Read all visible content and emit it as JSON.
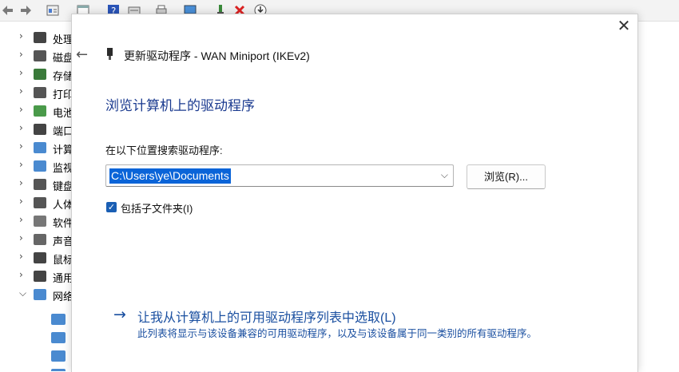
{
  "colors": {
    "accent": "#1a3a8f",
    "link": "#1a4fa0",
    "selection": "#0a64d8"
  },
  "background_tree": {
    "items": [
      {
        "label": "处理",
        "icon": "processor-icon",
        "expanded": false
      },
      {
        "label": "磁盘",
        "icon": "disk-drive-icon",
        "expanded": false
      },
      {
        "label": "存储",
        "icon": "storage-controller-icon",
        "expanded": false
      },
      {
        "label": "打印",
        "icon": "printer-icon",
        "expanded": false
      },
      {
        "label": "电池",
        "icon": "battery-icon",
        "expanded": false
      },
      {
        "label": "端口",
        "icon": "port-icon",
        "expanded": false
      },
      {
        "label": "计算",
        "icon": "computer-icon",
        "expanded": false
      },
      {
        "label": "监视",
        "icon": "monitor-icon",
        "expanded": false
      },
      {
        "label": "键盘",
        "icon": "keyboard-icon",
        "expanded": false
      },
      {
        "label": "人体",
        "icon": "hid-icon",
        "expanded": false
      },
      {
        "label": "软件",
        "icon": "software-device-icon",
        "expanded": false
      },
      {
        "label": "声音",
        "icon": "sound-icon",
        "expanded": false
      },
      {
        "label": "鼠标",
        "icon": "mouse-icon",
        "expanded": false
      },
      {
        "label": "通用",
        "icon": "usb-icon",
        "expanded": false
      },
      {
        "label": "网络",
        "icon": "network-adapter-icon",
        "expanded": true
      }
    ]
  },
  "dialog": {
    "title": "更新驱动程序 - WAN Miniport (IKEv2)",
    "heading": "浏览计算机上的驱动程序",
    "search_label": "在以下位置搜索驱动程序:",
    "path_value": "C:\\Users\\ye\\Documents",
    "browse_label": "浏览(R)...",
    "include_subfolders_label": "包括子文件夹(I)",
    "include_subfolders_checked": true,
    "pick_link": "让我从计算机上的可用驱动程序列表中选取(L)",
    "pick_desc": "此列表将显示与该设备兼容的可用驱动程序，以及与该设备属于同一类别的所有驱动程序。",
    "close_symbol": "✕",
    "back_symbol": "←",
    "check_symbol": "✓",
    "arrow_symbol": "→",
    "dropdown_symbol": "⌵"
  }
}
